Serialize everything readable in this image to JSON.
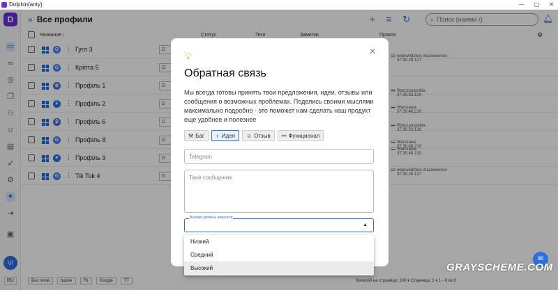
{
  "app": {
    "title": "Dolphin{anty}",
    "brand_letter": "D"
  },
  "header": {
    "title": "Все профили",
    "search_placeholder": "Поиск (нажми /)"
  },
  "table": {
    "col_name": "Название",
    "col_status": "Статус",
    "col_tags": "Теги",
    "col_notes": "Заметки",
    "col_proxy": "Прокси"
  },
  "rows": [
    {
      "name": "Гугл 3",
      "browser": "G",
      "status": "D"
    },
    {
      "name": "Кріпта 5",
      "browser": "G",
      "status": "D"
    },
    {
      "name": "Профіль 1",
      "browser": "⊕",
      "status": "D"
    },
    {
      "name": "Профіль 2",
      "browser": "F",
      "status": "D"
    },
    {
      "name": "Профіль 6",
      "browser": "₿",
      "status": "D"
    },
    {
      "name": "Профіль 8",
      "browser": "G",
      "status": "D"
    },
    {
      "name": "Профіль 3",
      "browser": "F",
      "status": "D"
    },
    {
      "name": "Tik Tok 4",
      "browser": "G",
      "status": "D"
    }
  ],
  "proxies": [
    {
      "region": "województwo mazowieckie",
      "ip": "37.30.28.127"
    },
    {
      "region": "Rzeczpospolita",
      "ip": "37.30.33.126"
    },
    {
      "region": "Warszawa",
      "ip": "37.30.48.210"
    },
    {
      "region": "Rzeczpospolita",
      "ip": "37.30.33.126"
    },
    {
      "region": "Warszawa",
      "ip": "37.30.48.210"
    },
    {
      "region": "Warszawa",
      "ip": "37.30.48.210"
    },
    {
      "region": "województwo mazowieckie",
      "ip": "37.30.28.127"
    }
  ],
  "modal": {
    "title": "Обратная связь",
    "description": "Мы всегда готовы принять твои предложения, идеи, отзывы или сообщения о возможных проблемах. Поделись своими мыслями максимально подробно - это поможет нам сделать наш продукт еще удобнее и полезнее",
    "chips": [
      "Баг",
      "Идея",
      "Отзыв",
      "Функционал"
    ],
    "telegram_placeholder": "Telegram",
    "message_placeholder": "Твоё сообщение",
    "importance_label": "Выбери уровень важности",
    "options": [
      "Низкий",
      "Средний",
      "Высокий"
    ]
  },
  "footer": {
    "tags": [
      "Без тегов",
      "bazier",
      "Fb",
      "Google",
      "TT"
    ],
    "pagination": "Записей на странице:  100  ▾    Страница:  1  ▾   1 - 8 из 8"
  },
  "rail": {
    "avatar": "VI",
    "lang": "RU"
  },
  "watermark": "GRAYSCHEME.COM",
  "colors": {
    "accent": "#2f6bd1",
    "brand": "#6b2fd6"
  }
}
